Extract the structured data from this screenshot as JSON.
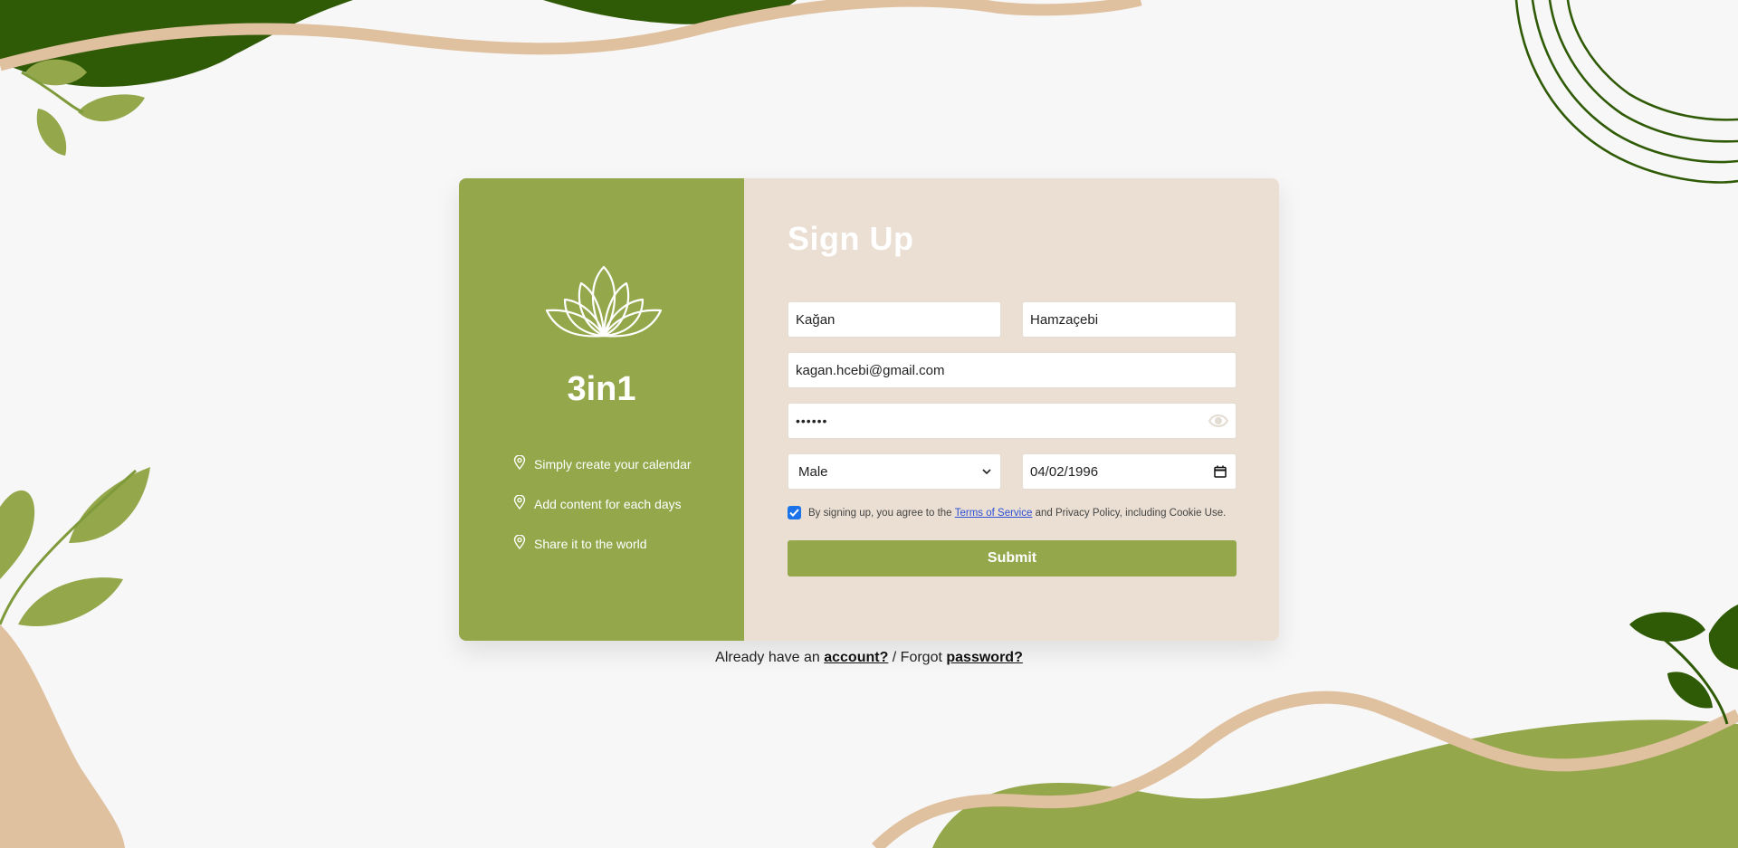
{
  "brand": {
    "name": "3in1",
    "logo_icon": "lotus-icon",
    "features": [
      {
        "icon": "location-pin-icon",
        "label": "Simply create your calendar"
      },
      {
        "icon": "location-pin-icon",
        "label": "Add content for each days"
      },
      {
        "icon": "location-pin-icon",
        "label": "Share it to the world"
      }
    ]
  },
  "form": {
    "title": "Sign Up",
    "first_name": "Kağan",
    "last_name": "Hamzaçebi",
    "email": "kagan.hcebi@gmail.com",
    "password_masked": "••••••",
    "gender": "Male",
    "birth_date": "04/02/1996",
    "consent": {
      "checked": true,
      "prefix": "By signing up, you agree to the ",
      "terms_link": "Terms of Service",
      "suffix": " and Privacy Policy, including Cookie Use."
    },
    "submit_label": "Submit"
  },
  "footer": {
    "prefix": "Already have an ",
    "account_link": "account?",
    "middle": " / Forgot ",
    "password_link": "password?"
  },
  "colors": {
    "olive": "#94a74b",
    "dark_green": "#2f5a06",
    "sand": "#dfc09f",
    "panel": "#eadfd2",
    "background": "#f7f7f7"
  }
}
